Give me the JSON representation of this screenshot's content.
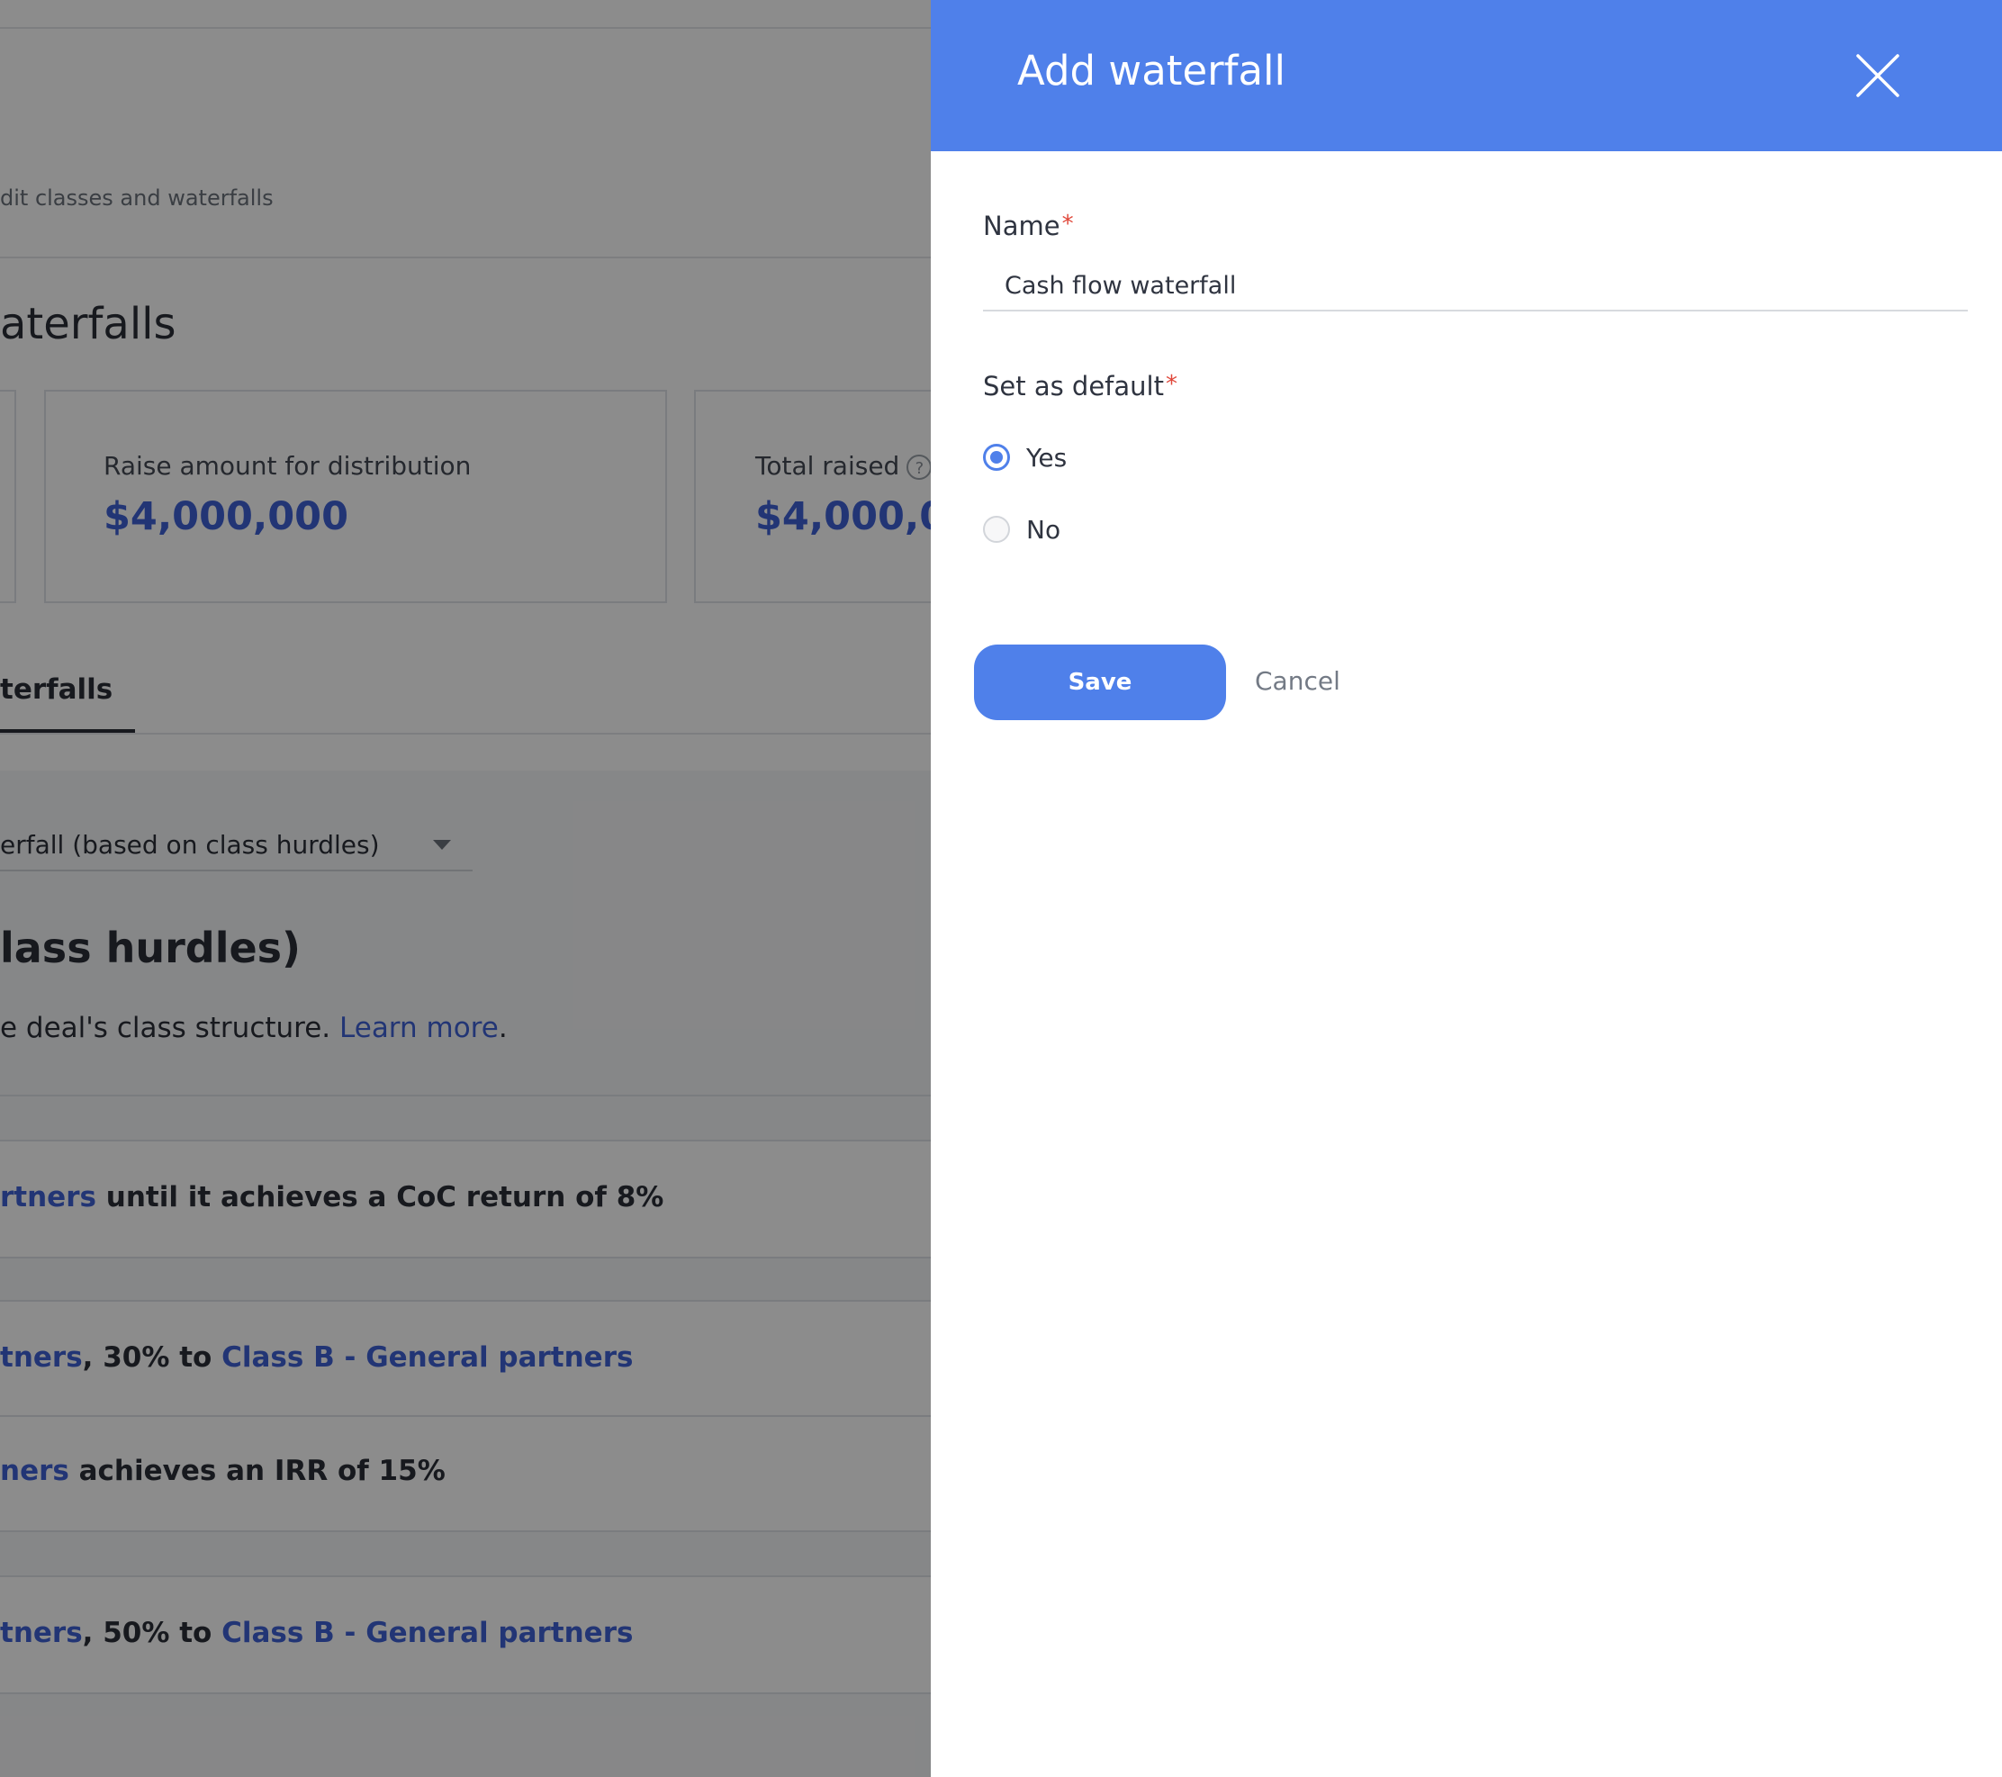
{
  "background": {
    "breadcrumb": "dit classes and waterfalls",
    "page_title": "aterfalls",
    "cards": [
      {
        "label": "Raise amount for distribution",
        "value": "$4,000,000",
        "has_help": false
      },
      {
        "label": "Total raised",
        "value": "$4,000,0",
        "has_help": true
      }
    ],
    "help_glyph": "?",
    "active_tab": "terfalls",
    "waterfall_select": "erfall (based on class hurdles)",
    "section_heading": "lass hurdles)",
    "description_prefix": "e deal's class structure. ",
    "learn_more": "Learn more",
    "description_suffix": ".",
    "tiers": [
      {
        "link": "rtners",
        "text": " until it achieves a CoC return of 8%"
      },
      {
        "link": "tners",
        "text": ", 30% to ",
        "link2": "Class B - General partners"
      },
      {
        "link": "ners",
        "text": " achieves an IRR of 15%"
      },
      {
        "link": "tners",
        "text": ", 50% to ",
        "link2": "Class B - General partners"
      }
    ]
  },
  "drawer": {
    "title": "Add waterfall",
    "name_label": "Name",
    "required_mark": "*",
    "name_value": "Cash flow waterfall",
    "default_label": "Set as default",
    "options": [
      {
        "label": "Yes",
        "checked": true
      },
      {
        "label": "No",
        "checked": false
      }
    ],
    "save_label": "Save",
    "cancel_label": "Cancel"
  },
  "colors": {
    "accent": "#4f80ea",
    "link": "#3f62d6",
    "required": "#e0473a",
    "overlay": "rgba(0,0,0,0.45)"
  },
  "icons": {
    "close": "close-icon",
    "dropdown": "caret-down-icon",
    "help": "help-icon"
  }
}
